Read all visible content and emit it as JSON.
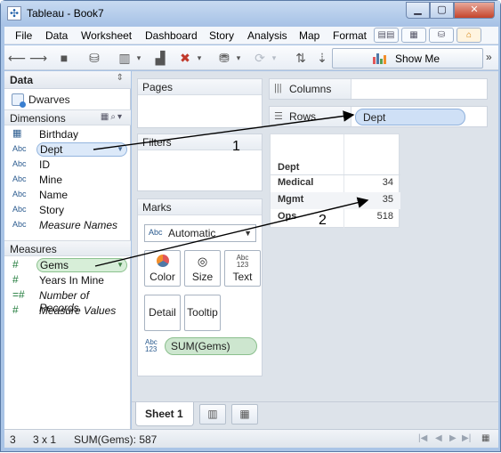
{
  "window": {
    "title": "Tableau - Book7"
  },
  "menu": [
    "File",
    "Data",
    "Worksheet",
    "Dashboard",
    "Story",
    "Analysis",
    "Map",
    "Format"
  ],
  "toolbar": {
    "show_me_label": "Show Me"
  },
  "data_pane": {
    "title": "Data",
    "datasource": "Dwarves",
    "dimensions_label": "Dimensions",
    "dimensions": [
      {
        "type": "date",
        "label": "Birthday"
      },
      {
        "type": "Abc",
        "label": "Dept"
      },
      {
        "type": "Abc",
        "label": "ID"
      },
      {
        "type": "Abc",
        "label": "Mine"
      },
      {
        "type": "Abc",
        "label": "Name"
      },
      {
        "type": "Abc",
        "label": "Story"
      },
      {
        "type": "Abc",
        "label": "Measure Names"
      }
    ],
    "measures_label": "Measures",
    "measures": [
      {
        "type": "#",
        "label": "Gems"
      },
      {
        "type": "#",
        "label": "Years In Mine"
      },
      {
        "type": "=#",
        "label": "Number of Records"
      },
      {
        "type": "#",
        "label": "Measure Values"
      }
    ]
  },
  "shelves": {
    "pages_label": "Pages",
    "filters_label": "Filters",
    "columns_label": "Columns",
    "rows_label": "Rows",
    "rows_pill": "Dept"
  },
  "marks": {
    "title": "Marks",
    "type_abc": "Abc",
    "type": "Automatic",
    "buttons": [
      "Color",
      "Size",
      "Text",
      "Detail",
      "Tooltip"
    ],
    "size_abc_top": "Abc",
    "size_abc_bottom": "123",
    "pill": "SUM(Gems)"
  },
  "viz": {
    "header": "Dept",
    "rows": [
      {
        "dept": "Medical",
        "value": "34"
      },
      {
        "dept": "Mgmt",
        "value": "35"
      },
      {
        "dept": "Ops",
        "value": "518"
      }
    ]
  },
  "sheets": {
    "active": "Sheet 1"
  },
  "status": {
    "marks": "3",
    "dims": "3 x 1",
    "sum": "SUM(Gems): 587"
  },
  "annotations": {
    "one": "1",
    "two": "2"
  },
  "colors": {
    "dimension_pill": "#cfe0f6",
    "measure_pill": "#cde6cf",
    "accent": "#2b5b8f"
  }
}
